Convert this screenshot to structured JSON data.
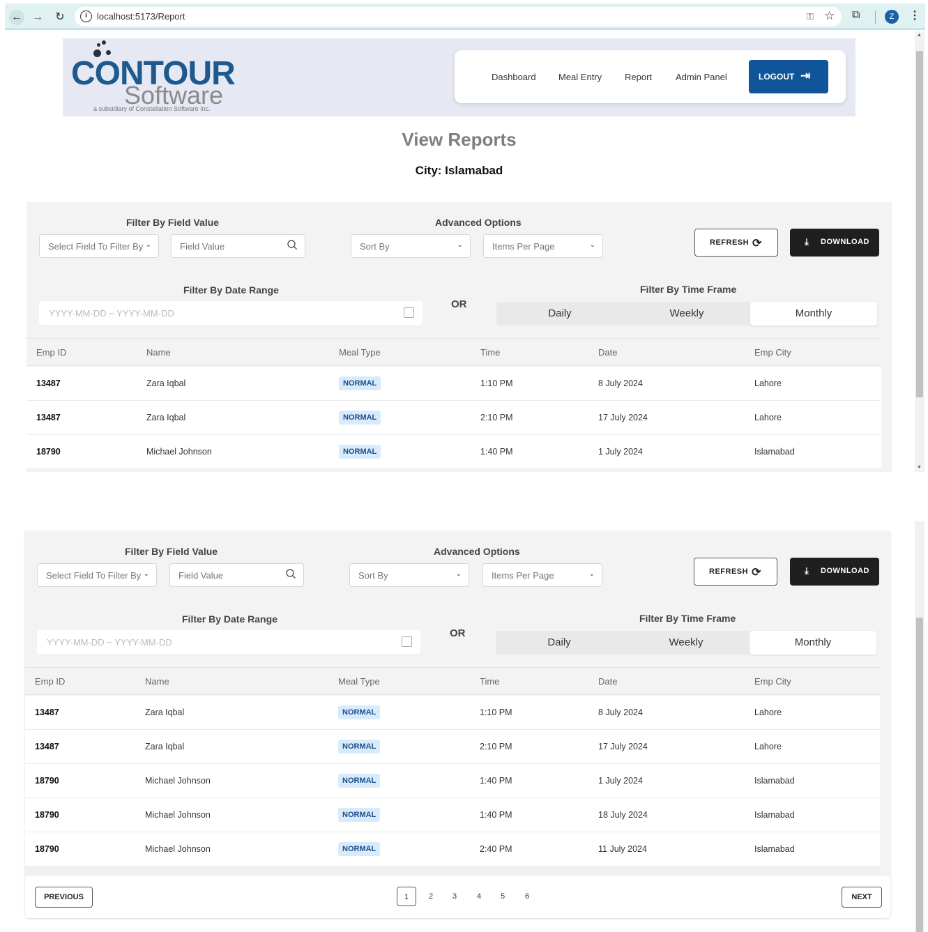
{
  "browser": {
    "url": "localhost:5173/Report",
    "profile_initial": "Z"
  },
  "header": {
    "logo_main": "CONTOUR",
    "logo_software": "Software",
    "logo_sub": "a subsidiary of Constellation Software Inc.",
    "nav": [
      "Dashboard",
      "Meal Entry",
      "Report",
      "Admin Panel"
    ],
    "logout_label": "LOGOUT"
  },
  "page": {
    "title": "View Reports",
    "city_line": "City: Islamabad"
  },
  "filters": {
    "field_value_label": "Filter By Field Value",
    "field_select_placeholder": "Select Field To Filter By",
    "field_value_placeholder": "Field Value",
    "advanced_label": "Advanced Options",
    "sort_placeholder": "Sort By",
    "items_per_page_placeholder": "Items Per Page",
    "refresh_label": "REFRESH",
    "download_label": "DOWNLOAD",
    "date_range_label": "Filter By Date Range",
    "date_range_placeholder": "YYYY-MM-DD ~ YYYY-MM-DD",
    "or_label": "OR",
    "time_frame_label": "Filter By Time Frame",
    "time_frames": [
      "Daily",
      "Weekly",
      "Monthly"
    ],
    "active_time_frame": "Monthly"
  },
  "table": {
    "columns": [
      "Emp ID",
      "Name",
      "Meal Type",
      "Time",
      "Date",
      "Emp City"
    ],
    "rows": [
      {
        "id": "13487",
        "name": "Zara Iqbal",
        "meal": "NORMAL",
        "time": "1:10 PM",
        "date": "8 July 2024",
        "city": "Lahore"
      },
      {
        "id": "13487",
        "name": "Zara Iqbal",
        "meal": "NORMAL",
        "time": "2:10 PM",
        "date": "17 July 2024",
        "city": "Lahore"
      },
      {
        "id": "18790",
        "name": "Michael Johnson",
        "meal": "NORMAL",
        "time": "1:40 PM",
        "date": "1 July 2024",
        "city": "Islamabad"
      },
      {
        "id": "18790",
        "name": "Michael Johnson",
        "meal": "NORMAL",
        "time": "1:40 PM",
        "date": "18 July 2024",
        "city": "Islamabad"
      },
      {
        "id": "18790",
        "name": "Michael Johnson",
        "meal": "NORMAL",
        "time": "2:40 PM",
        "date": "11 July 2024",
        "city": "Islamabad"
      }
    ]
  },
  "pagination": {
    "previous_label": "PREVIOUS",
    "next_label": "NEXT",
    "pages": [
      "1",
      "2",
      "3",
      "4",
      "5",
      "6"
    ],
    "current_page": "1"
  },
  "colors": {
    "brand_blue": "#10559a",
    "badge_bg": "#d8ebfb",
    "panel_bg": "#f3f3f3"
  }
}
